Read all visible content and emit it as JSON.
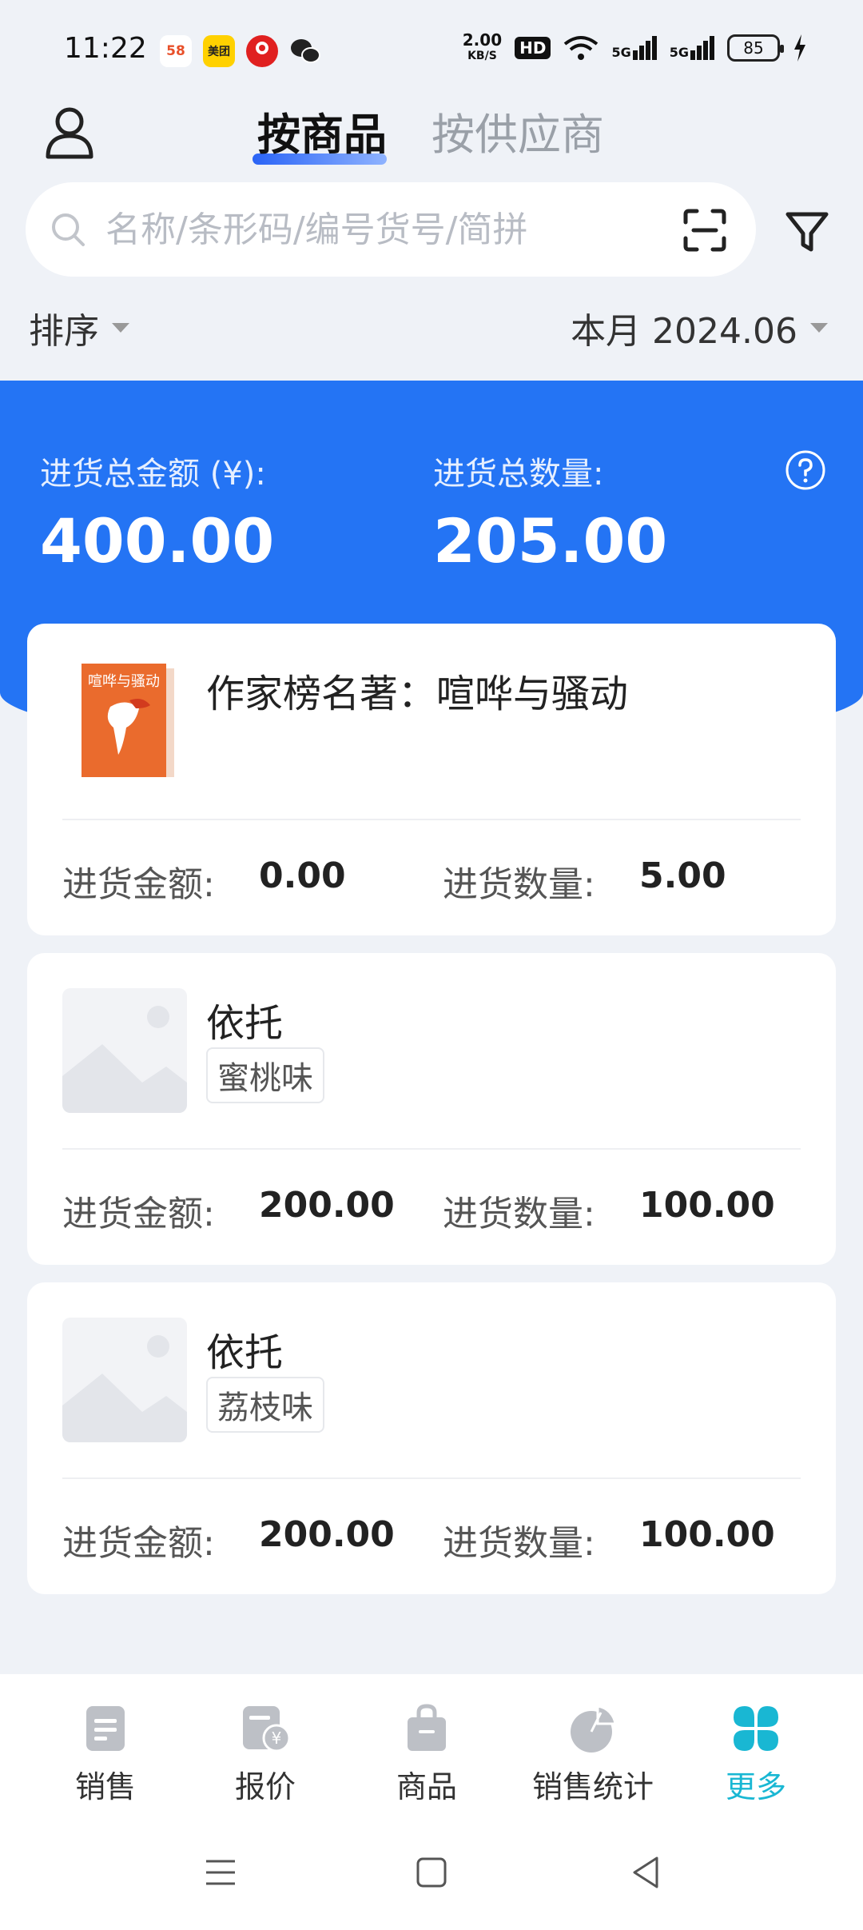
{
  "status_bar": {
    "time": "11:22",
    "apps": [
      "58",
      "美团",
      "",
      ""
    ],
    "net_speed_value": "2.00",
    "net_speed_unit": "KB/S",
    "hd_badge": "HD",
    "signal_1": "5G",
    "signal_2": "5G",
    "battery": "85"
  },
  "header": {
    "tab_goods": "按商品",
    "tab_supplier": "按供应商"
  },
  "search": {
    "placeholder": "名称/条形码/编号货号/简拼"
  },
  "sort": {
    "sort_label": "排序",
    "month_label": "本月 2024.06"
  },
  "summary": {
    "amount_label": "进货总金额 (¥):",
    "amount_value": "400.00",
    "qty_label": "进货总数量:",
    "qty_value": "205.00"
  },
  "items": [
    {
      "name": "作家榜名著：喧哗与骚动",
      "tag": "",
      "amount_label": "进货金额:",
      "amount_value": "0.00",
      "qty_label": "进货数量:",
      "qty_value": "5.00",
      "cover_title": "喧哗与骚动"
    },
    {
      "name": "依托",
      "tag": "蜜桃味",
      "amount_label": "进货金额:",
      "amount_value": "200.00",
      "qty_label": "进货数量:",
      "qty_value": "100.00"
    },
    {
      "name": "依托",
      "tag": "荔枝味",
      "amount_label": "进货金额:",
      "amount_value": "200.00",
      "qty_label": "进货数量:",
      "qty_value": "100.00"
    }
  ],
  "bottom_nav": {
    "sales": "销售",
    "quote": "报价",
    "goods": "商品",
    "stats": "销售统计",
    "more": "更多"
  },
  "colors": {
    "primary": "#2474f4",
    "active_nav": "#19b7d3",
    "background": "#eff2f7"
  }
}
